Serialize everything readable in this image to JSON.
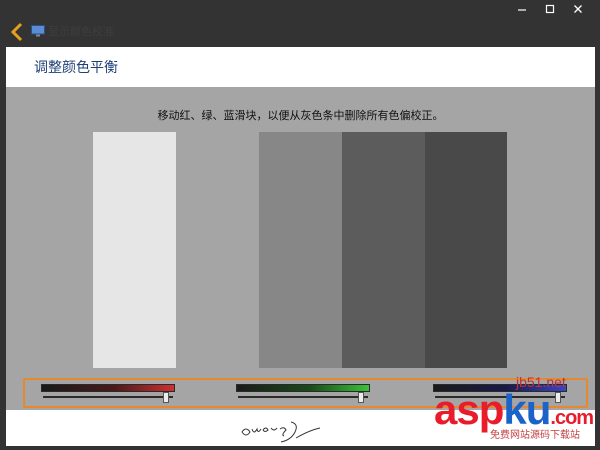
{
  "window": {
    "title": "显示颜色校准",
    "icons": {
      "back": "chevron-left-icon",
      "app": "monitor-icon",
      "minimize": "minimize-icon",
      "maximize": "maximize-icon",
      "close": "close-icon"
    }
  },
  "header": {
    "title": "调整颜色平衡"
  },
  "main": {
    "instruction": "移动红、绿、蓝滑块，以便从灰色条中删除所有色偏校正。",
    "gray_bars": [
      "#e6e6e6",
      "#a5a5a5",
      "#878787",
      "#5c5c5c",
      "#494949"
    ],
    "sliders": [
      {
        "name": "red",
        "color": "#d03030",
        "level": 0.95
      },
      {
        "name": "green",
        "color": "#39c339",
        "level": 0.95
      },
      {
        "name": "blue",
        "color": "#3846c8",
        "level": 0.95
      }
    ],
    "highlight_color": "#e7882e"
  },
  "watermark": {
    "site_small": "jb51.net",
    "logo_a": "asp",
    "logo_b": "ku",
    "logo_c": ".com",
    "subtitle": "免费网站源码下载站"
  }
}
